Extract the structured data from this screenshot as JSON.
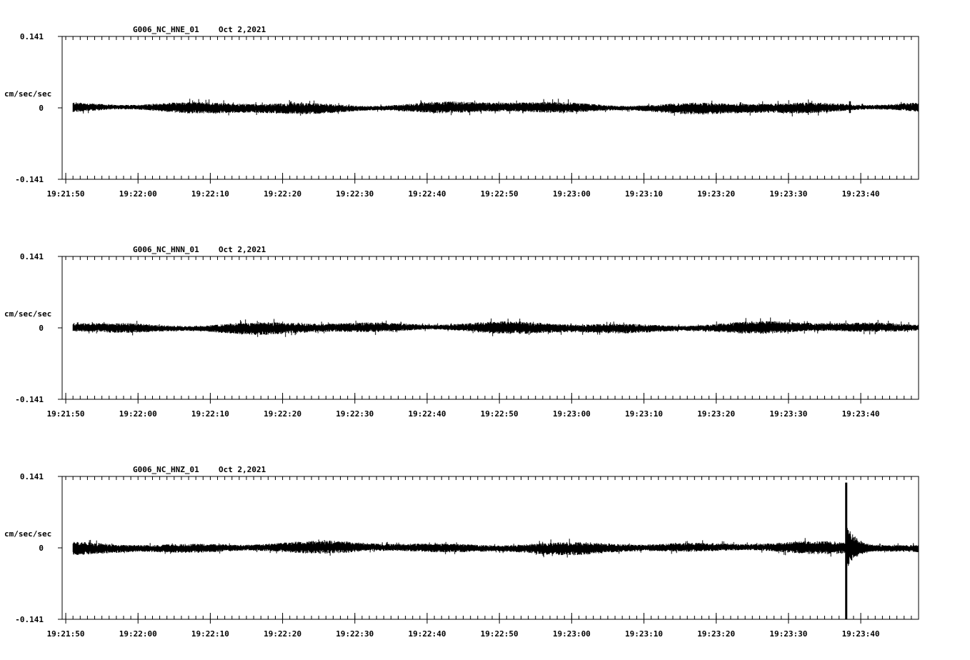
{
  "chart_data": [
    {
      "type": "line",
      "channel": "G006_NC_HNE_01",
      "date": "Oct 2,2021",
      "ylabel": "cm/sec/sec",
      "y_ticks": [
        "0.141",
        "0",
        "-0.141"
      ],
      "ylim": [
        -0.141,
        0.141
      ],
      "x_ticks": [
        "19:21:50",
        "19:22:00",
        "19:22:10",
        "19:22:20",
        "19:22:30",
        "19:22:40",
        "19:22:50",
        "19:23:00",
        "19:23:10",
        "19:23:20",
        "19:23:30",
        "19:23:40"
      ],
      "x_start_seconds": 49.5,
      "x_end_seconds": 168,
      "data_start_seconds": 51,
      "noise_amplitude": 0.011,
      "events": [
        {
          "time_seconds": 158.5,
          "peak": 0.012,
          "trough": -0.011
        }
      ]
    },
    {
      "type": "line",
      "channel": "G006_NC_HNN_01",
      "date": "Oct 2,2021",
      "ylabel": "cm/sec/sec",
      "y_ticks": [
        "0.141",
        "0",
        "-0.141"
      ],
      "ylim": [
        -0.141,
        0.141
      ],
      "x_ticks": [
        "19:21:50",
        "19:22:00",
        "19:22:10",
        "19:22:20",
        "19:22:30",
        "19:22:40",
        "19:22:50",
        "19:23:00",
        "19:23:10",
        "19:23:20",
        "19:23:30",
        "19:23:40"
      ],
      "x_start_seconds": 49.5,
      "x_end_seconds": 168,
      "data_start_seconds": 51,
      "noise_amplitude": 0.011,
      "events": []
    },
    {
      "type": "line",
      "channel": "G006_NC_HNZ_01",
      "date": "Oct 2,2021",
      "ylabel": "cm/sec/sec",
      "y_ticks": [
        "0.141",
        "0",
        "-0.141"
      ],
      "ylim": [
        -0.141,
        0.141
      ],
      "x_ticks": [
        "19:21:50",
        "19:22:00",
        "19:22:10",
        "19:22:20",
        "19:22:30",
        "19:22:40",
        "19:22:50",
        "19:23:00",
        "19:23:10",
        "19:23:20",
        "19:23:30",
        "19:23:40"
      ],
      "x_start_seconds": 49.5,
      "x_end_seconds": 168,
      "data_start_seconds": 51,
      "noise_amplitude": 0.011,
      "events": [
        {
          "time_seconds": 158.0,
          "peak": 0.129,
          "trough": -0.141
        }
      ]
    }
  ]
}
